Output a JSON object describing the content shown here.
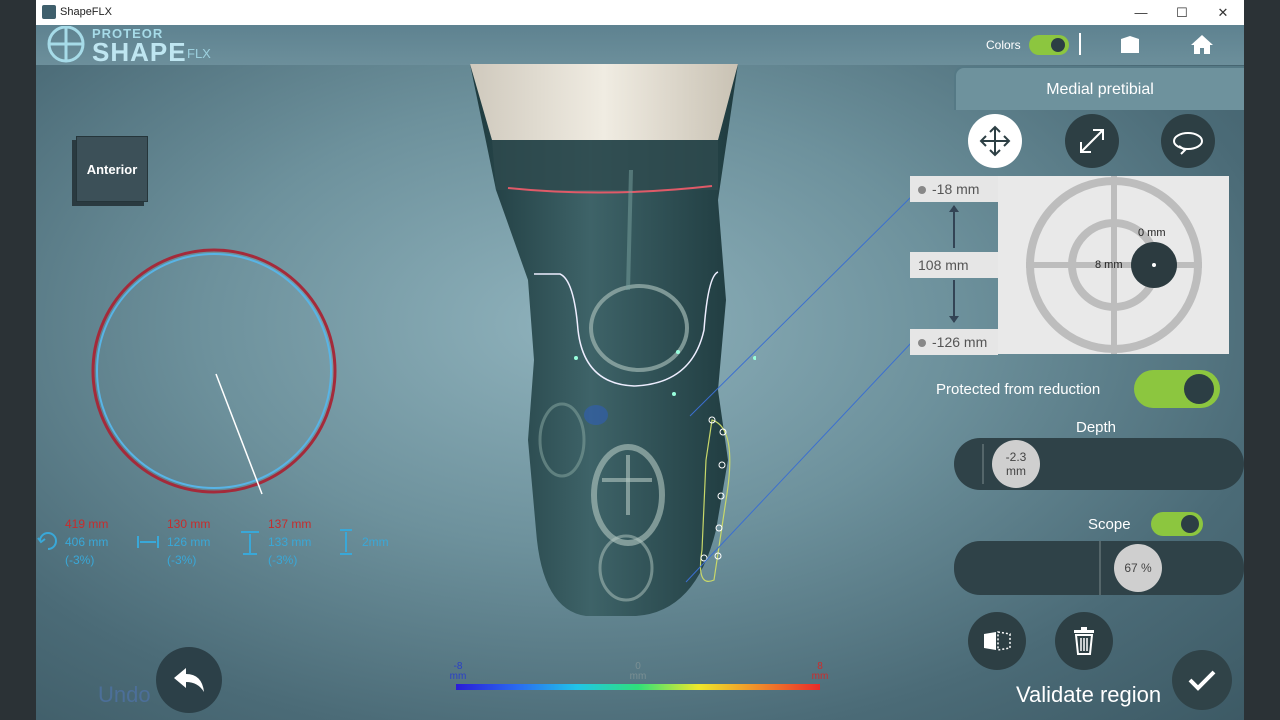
{
  "window": {
    "title": "ShapeFLX",
    "minimize": "—",
    "maximize": "☐",
    "close": "✕"
  },
  "logo": {
    "top": "PROTEOR",
    "main": "SHAPE",
    "sub": "FLX"
  },
  "header": {
    "colors_label": "Colors",
    "colors_on": true
  },
  "view_cube": {
    "label": "Anterior"
  },
  "panel": {
    "title": "Medial pretibial",
    "tools": [
      "move-icon",
      "resize-icon",
      "rotate-icon"
    ],
    "range_top": "-18 mm",
    "range_length": "108 mm",
    "range_bottom": "-126 mm",
    "target_label_v": "0 mm",
    "target_label_h": "8 mm",
    "protected_label": "Protected from reduction",
    "protected_on": true,
    "depth_label": "Depth",
    "depth_value": "-2.3",
    "depth_unit": "mm",
    "scope_label": "Scope",
    "scope_on": true,
    "scope_value": "67 %",
    "validate_label": "Validate region"
  },
  "measurements": [
    {
      "red": "419 mm",
      "blue": "406 mm",
      "pct": "(-3%)",
      "icon": "circumference-icon"
    },
    {
      "red": "130 mm",
      "blue": "126 mm",
      "pct": "(-3%)",
      "icon": "width-icon"
    },
    {
      "red": "137 mm",
      "blue": "133 mm",
      "pct": "(-3%)",
      "icon": "height-icon"
    },
    {
      "red": "",
      "blue": "2mm",
      "pct": "",
      "icon": "offset-icon"
    }
  ],
  "undo_label": "Undo",
  "colorbar": {
    "min": "-8",
    "mid": "0",
    "max": "8",
    "unit": "mm"
  },
  "colors": {
    "accent": "#8cc63f",
    "red": "#c62d2d",
    "blue": "#39a8d8"
  }
}
